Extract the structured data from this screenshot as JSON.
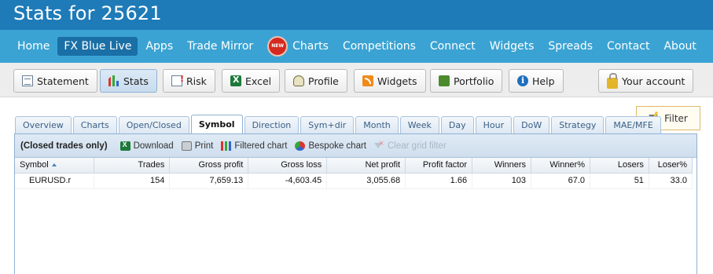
{
  "title": "Stats for 25621",
  "mainnav": {
    "items": [
      "Home",
      "FX Blue Live",
      "Apps",
      "Trade Mirror",
      "Charts",
      "Competitions",
      "Connect",
      "Widgets",
      "Spreads",
      "Contact",
      "About"
    ],
    "new_badge": "NEW",
    "active": "FX Blue Live"
  },
  "toolbar": {
    "statement": "Statement",
    "stats": "Stats",
    "risk": "Risk",
    "excel": "Excel",
    "profile": "Profile",
    "widgets": "Widgets",
    "portfolio": "Portfolio",
    "help": "Help",
    "account": "Your account",
    "active": "Stats"
  },
  "filter": {
    "label": "Filter"
  },
  "tabs": {
    "items": [
      "Overview",
      "Charts",
      "Open/Closed",
      "Symbol",
      "Direction",
      "Sym+dir",
      "Month",
      "Week",
      "Day",
      "Hour",
      "DoW",
      "Strategy",
      "MAE/MFE"
    ],
    "active": "Symbol"
  },
  "gridbar": {
    "lead": "(Closed trades only)",
    "download": "Download",
    "print": "Print",
    "filtered_chart": "Filtered chart",
    "bespoke_chart": "Bespoke chart",
    "clear_filter": "Clear grid filter"
  },
  "table": {
    "columns": [
      "Symbol",
      "Trades",
      "Gross profit",
      "Gross loss",
      "Net profit",
      "Profit factor",
      "Winners",
      "Winner%",
      "Losers",
      "Loser%"
    ],
    "rows": [
      [
        "EURUSD.r",
        "154",
        "7,659.13",
        "-4,603.45",
        "3,055.68",
        "1.66",
        "103",
        "67.0",
        "51",
        "33.0"
      ]
    ]
  },
  "colors": {
    "title_bar": "#1e7bb8",
    "nav_bar": "#3aa3d3",
    "nav_active": "#1a6fa6"
  }
}
